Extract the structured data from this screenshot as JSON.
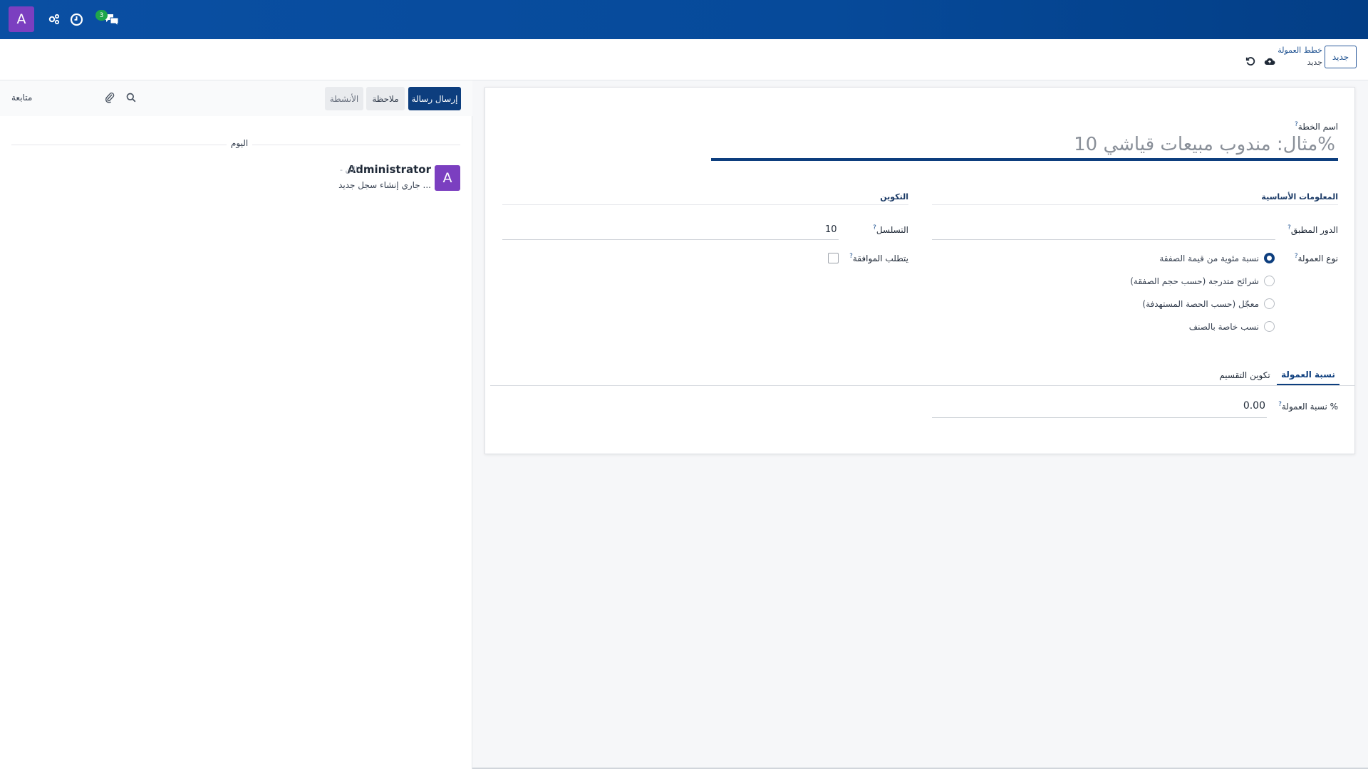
{
  "navbar": {
    "user_initial": "A",
    "messages_count": "3",
    "icons": [
      "apps-connect-icon",
      "clock-icon",
      "chat-icon"
    ]
  },
  "control_panel": {
    "new_button": "جديد",
    "breadcrumb_parent": "خطط العمولة",
    "breadcrumb_current": "جديد"
  },
  "chatter": {
    "send_message": "إرسال رسالة",
    "log_note": "ملاحظة",
    "activities": "الأنشطة",
    "follow": "متابعة",
    "day_separator": "اليوم",
    "message": {
      "author_initial": "A",
      "author": "Administrator",
      "time": "- الآن",
      "body": "جاري إنشاء سجل جديد ..."
    }
  },
  "form": {
    "plan_name_label": "اسم الخطة",
    "plan_name_placeholder": "مثال: مندوب مبيعات قياشي 10%",
    "section_basic": "المعلومات الأساسية",
    "section_config": "التكوين",
    "applies_to_label": "الدور المطبق",
    "commission_type_label": "نوع العمولة",
    "commission_type_options": [
      {
        "label": "نسبة مئوية من قيمة الصفقة",
        "selected": true
      },
      {
        "label": "شرائح متدرجة (حسب حجم الصفقة)",
        "selected": false
      },
      {
        "label": "معجّل (حسب الحصة المستهدفة)",
        "selected": false
      },
      {
        "label": "نسب خاصة بالصنف",
        "selected": false
      }
    ],
    "sequence_label": "التسلسل",
    "sequence_value": "10",
    "requires_approval_label": "يتطلب الموافقة",
    "requires_approval": false,
    "tabs": [
      "نسبة العمولة",
      "تكوين التقسيم"
    ],
    "active_tab": "نسبة العمولة",
    "commission_rate_label": "نسبة العمولة %",
    "commission_rate_value": "0.00"
  },
  "colors": {
    "navbar": "#0a4fa3",
    "primary": "#0d3e7e",
    "avatar": "#7b3fc0",
    "badge": "#1fa64a"
  }
}
